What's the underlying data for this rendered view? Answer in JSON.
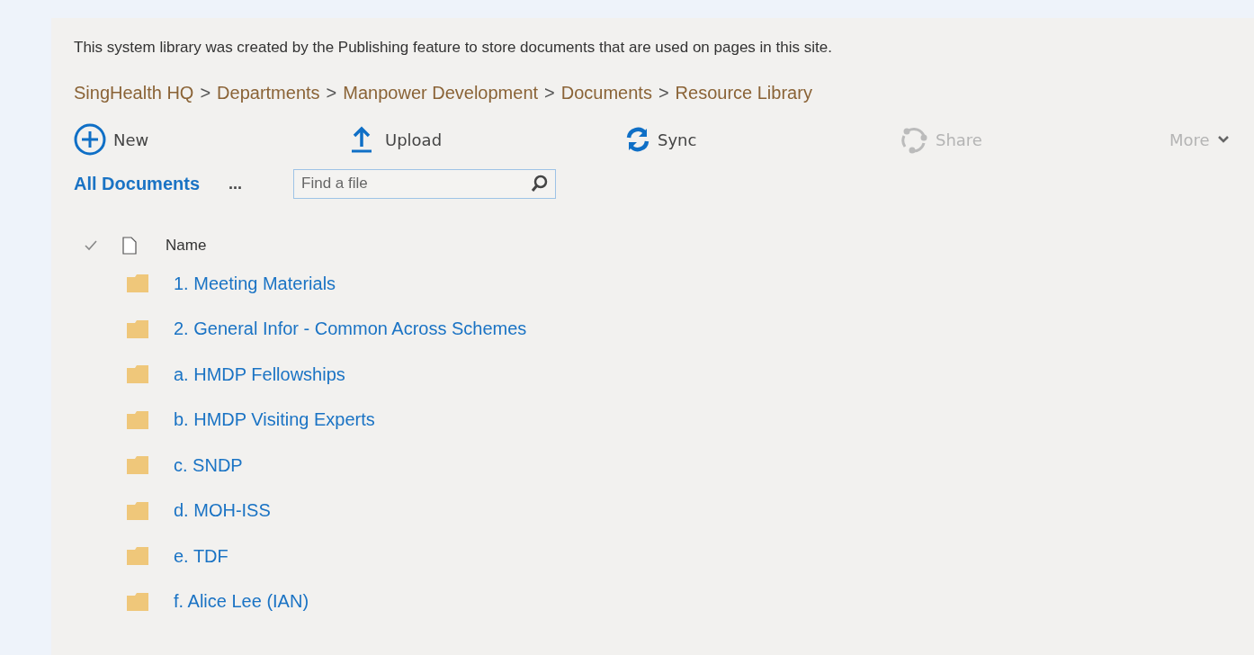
{
  "description": "This system library was created by the Publishing feature to store documents that are used on pages in this site.",
  "breadcrumb": {
    "separator": ">",
    "items": [
      "SingHealth HQ",
      "Departments",
      "Manpower Development",
      "Documents",
      "Resource Library"
    ]
  },
  "toolbar": [
    {
      "kind": "new",
      "label": "New",
      "disabled": false
    },
    {
      "kind": "upload",
      "label": "Upload",
      "disabled": false
    },
    {
      "kind": "sync",
      "label": "Sync",
      "disabled": false
    },
    {
      "kind": "share",
      "label": "Share",
      "disabled": true
    },
    {
      "kind": "more",
      "label": "More",
      "disabled": true
    }
  ],
  "view": {
    "label": "All Documents",
    "more": "...",
    "search": {
      "placeholder": "Find a file"
    }
  },
  "list": {
    "columns": [
      "Name"
    ],
    "rows": [
      {
        "name": "1. Meeting Materials"
      },
      {
        "name": "2. General Infor - Common Across Schemes"
      },
      {
        "name": "a. HMDP Fellowships"
      },
      {
        "name": "b. HMDP Visiting Experts"
      },
      {
        "name": "c. SNDP"
      },
      {
        "name": "d. MOH-ISS"
      },
      {
        "name": "e. TDF"
      },
      {
        "name": "f. Alice Lee (IAN)"
      }
    ]
  }
}
